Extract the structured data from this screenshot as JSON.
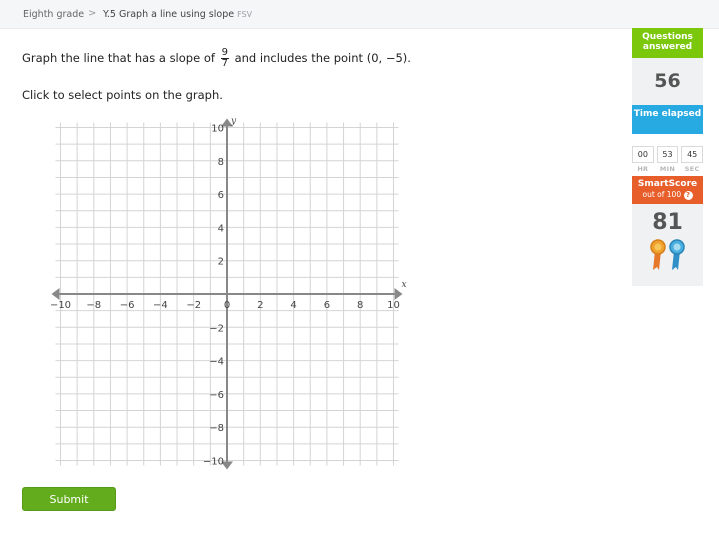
{
  "breadcrumb": {
    "grade": "Eighth grade",
    "separator": ">",
    "skill": "Y.5 Graph a line using slope",
    "code": "FSV"
  },
  "question": {
    "prefix": "Graph the line that has a slope of",
    "slope_numerator": "9",
    "slope_denominator": "7",
    "suffix": "and includes the point (0, −5).",
    "instruction": "Click to select points on the graph."
  },
  "graph": {
    "x_axis_label": "x",
    "y_axis_label": "y",
    "x_range": [
      -10,
      10
    ],
    "y_range": [
      -10,
      10
    ],
    "grid_step": 1,
    "x_tick_labels": [
      "−10",
      "−8",
      "−6",
      "−4",
      "−2",
      "0",
      "2",
      "4",
      "6",
      "8",
      "10"
    ],
    "x_tick_values": [
      -10,
      -8,
      -6,
      -4,
      -2,
      0,
      2,
      4,
      6,
      8,
      10
    ],
    "y_tick_labels": [
      "10",
      "8",
      "6",
      "4",
      "2",
      "−2",
      "−4",
      "−6",
      "−8",
      "−10"
    ],
    "y_tick_values": [
      10,
      8,
      6,
      4,
      2,
      -2,
      -4,
      -6,
      -8,
      -10
    ]
  },
  "submit": {
    "label": "Submit"
  },
  "sidebar": {
    "questions_answered_label": "Questions answered",
    "questions_answered_value": "56",
    "time_elapsed_label": "Time elapsed",
    "timer": {
      "hours": "00",
      "minutes": "53",
      "seconds": "45",
      "hr_label": "HR",
      "min_label": "MIN",
      "sec_label": "SEC"
    },
    "smartscore_label": "SmartScore",
    "smartscore_sub": "out of 100",
    "smartscore_info": "?",
    "smartscore_value": "81"
  },
  "colors": {
    "green": "#7ac70c",
    "blue": "#27a9e1",
    "orange": "#e85e2a",
    "submit": "#62ac1e",
    "grid": "#d4d4d4",
    "axis": "#888888"
  },
  "icons": [
    "chevron-right-icon",
    "info-icon",
    "ribbon-orange-icon",
    "ribbon-blue-icon"
  ]
}
